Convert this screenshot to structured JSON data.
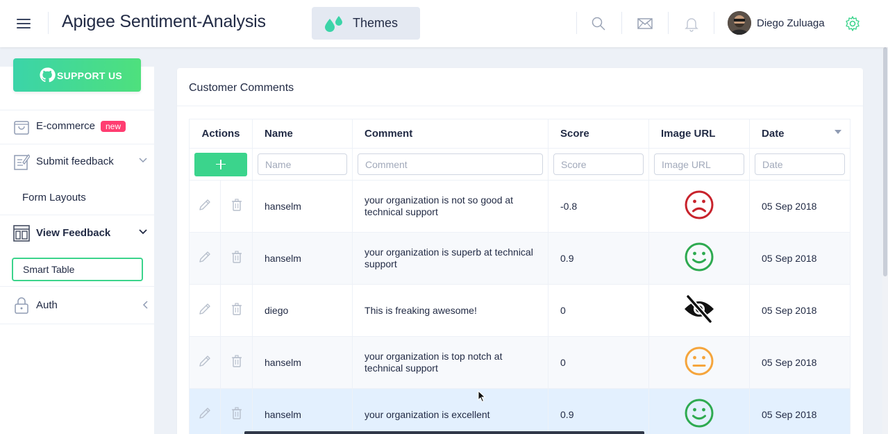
{
  "header": {
    "title": "Apigee Sentiment-Analysis",
    "themes_label": "Themes",
    "user_name": "Diego Zuluaga",
    "icons": [
      "menu-icon",
      "drops-icon",
      "search-icon",
      "mail-icon",
      "bell-icon",
      "gear-icon"
    ],
    "accent_color": "#3bd48c"
  },
  "sidebar": {
    "support_label": "SUPPORT US",
    "items": [
      {
        "label": "E-commerce",
        "icon": "shopping-bag-icon",
        "badge": "new"
      },
      {
        "label": "Submit feedback",
        "icon": "edit-icon"
      },
      {
        "label": "Form Layouts"
      },
      {
        "label": "View Feedback",
        "icon": "layout-icon"
      },
      {
        "label": "Smart Table"
      },
      {
        "label": "Auth",
        "icon": "lock-icon"
      }
    ]
  },
  "card": {
    "title": "Customer Comments",
    "columns": [
      "Actions",
      "Name",
      "Comment",
      "Score",
      "Image URL",
      "Date"
    ],
    "filters": {
      "name": "Name",
      "comment": "Comment",
      "score": "Score",
      "image": "Image URL",
      "date": "Date"
    },
    "rows": [
      {
        "name": "hanselm",
        "comment": "your organization is not so good at technical support",
        "score": "-0.8",
        "image": "sad-face-icon",
        "date": "05 Sep 2018"
      },
      {
        "name": "hanselm",
        "comment": "your organization is superb at technical support",
        "score": "0.9",
        "image": "happy-face-icon",
        "date": "05 Sep 2018"
      },
      {
        "name": "diego",
        "comment": "This is freaking awesome!",
        "score": "0",
        "image": "eye-off-icon",
        "date": "05 Sep 2018"
      },
      {
        "name": "hanselm",
        "comment": "your organization is top notch at technical support",
        "score": "0",
        "image": "neutral-face-icon",
        "date": "05 Sep 2018"
      },
      {
        "name": "hanselm",
        "comment": "your organization is excellent",
        "score": "0.9",
        "image": "happy-face-icon",
        "date": "05 Sep 2018"
      }
    ]
  }
}
